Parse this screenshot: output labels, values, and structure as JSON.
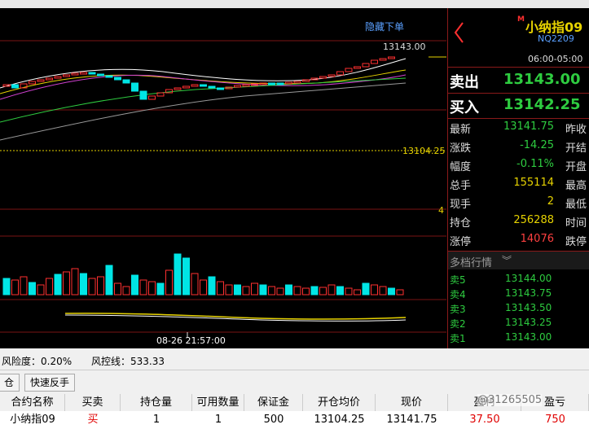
{
  "chart": {
    "hide_order_label": "隐藏下单",
    "high_label": "13143.00",
    "cost_label": "13104.25",
    "right_tick": "4",
    "time_label": "08-26 21:57:00"
  },
  "quote": {
    "symbol_name": "小纳指09",
    "badge": "M",
    "code": "NQ2209",
    "time": "06:00-05:00",
    "sell_label": "卖出",
    "sell_price": "13143.00",
    "buy_label": "买入",
    "buy_price": "13142.25",
    "rows": [
      {
        "label": "最新",
        "value": "13141.75",
        "value_color": "#2ecc40",
        "right": "昨收"
      },
      {
        "label": "涨跌",
        "value": "-14.25",
        "value_color": "#2ecc40",
        "right": "开结"
      },
      {
        "label": "幅度",
        "value": "-0.11%",
        "value_color": "#2ecc40",
        "right": "开盘"
      },
      {
        "label": "总手",
        "value": "155114",
        "value_color": "#e6d200",
        "right": "最高"
      },
      {
        "label": "现手",
        "value": "2",
        "value_color": "#e6d200",
        "right": "最低"
      },
      {
        "label": "持仓",
        "value": "256288",
        "value_color": "#e6d200",
        "right": "时间"
      },
      {
        "label": "涨停",
        "value": "14076",
        "value_color": "#ff4040",
        "right": "跌停"
      }
    ],
    "depth_title": "多档行情",
    "depth": [
      {
        "label": "卖5",
        "price": "13144.00"
      },
      {
        "label": "卖4",
        "price": "13143.75"
      },
      {
        "label": "卖3",
        "price": "13143.50"
      },
      {
        "label": "卖2",
        "price": "13143.25"
      },
      {
        "label": "卖1",
        "price": "13143.00"
      }
    ]
  },
  "account": {
    "risk_label": "风险度：",
    "risk_value": "0.20%",
    "control_label": "风控线：",
    "control_value": "533.33"
  },
  "buttons": {
    "close_partial": "仓",
    "quick_reverse": "快速反手"
  },
  "positions": {
    "headers": [
      "合约名称",
      "买卖",
      "持仓量",
      "可用数量",
      "保证金",
      "开仓均价",
      "现价",
      "盈利",
      "盈亏"
    ],
    "row": [
      "小纳指09",
      "买",
      "1",
      "1",
      "500",
      "13104.25",
      "13141.75",
      "37.50",
      "750"
    ],
    "watermark": "@31265505"
  },
  "colors": {
    "up": "#ff3030",
    "down": "#00e5e5",
    "grid": "#8a1a1a"
  }
}
